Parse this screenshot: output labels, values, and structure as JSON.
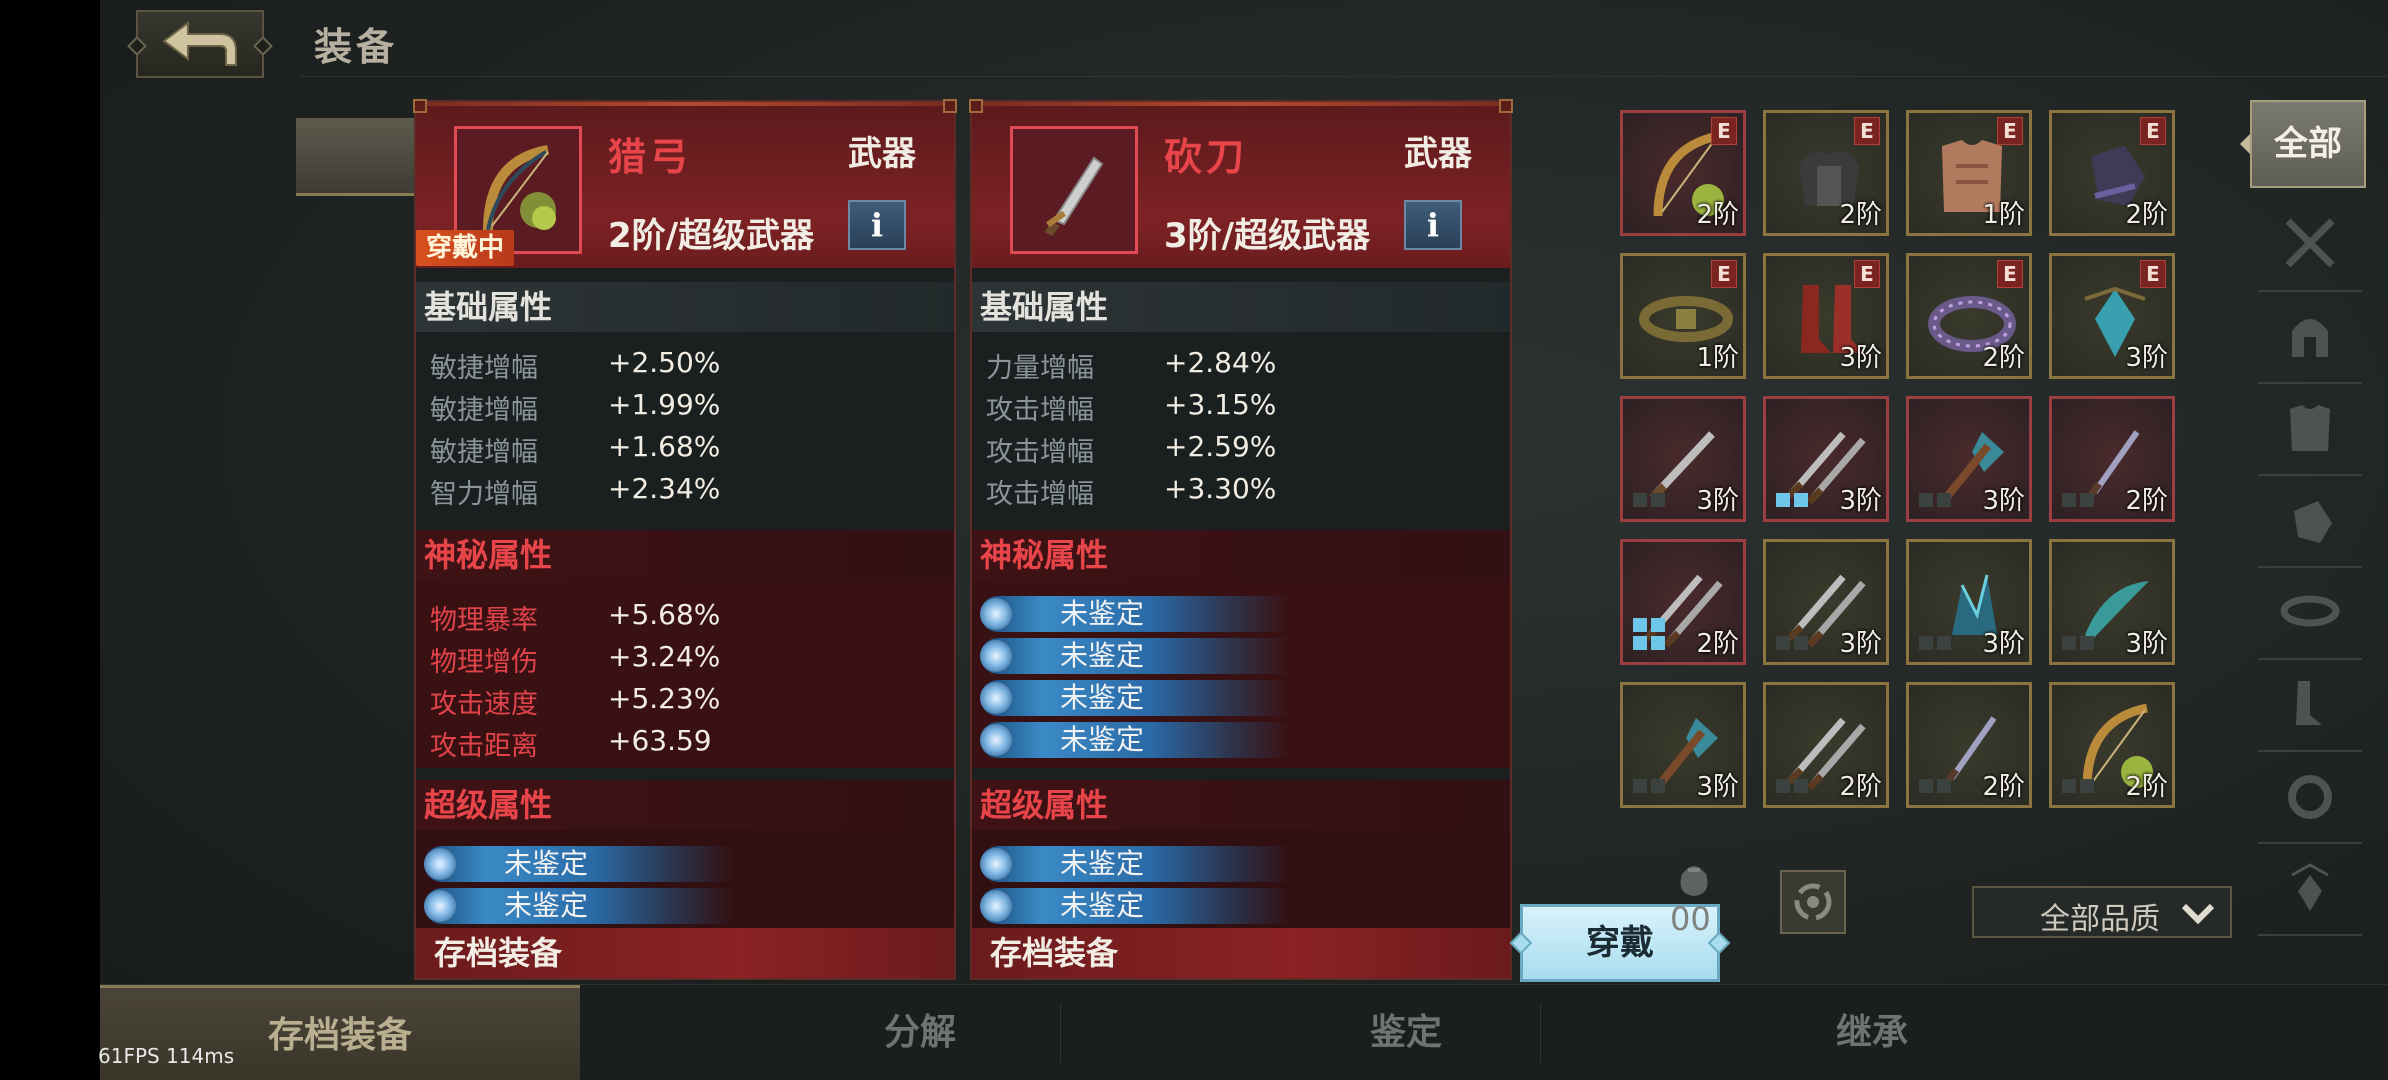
{
  "header": {
    "title": "装备",
    "back_icon": "back-arrow-icon"
  },
  "cards": [
    {
      "name": "猎弓",
      "type": "武器",
      "tier": "2阶/超级武器",
      "equipped_badge": "穿戴中",
      "icon": "bow-icon",
      "basic_title": "基础属性",
      "basic": [
        {
          "label": "敏捷增幅",
          "value": "+2.50%"
        },
        {
          "label": "敏捷增幅",
          "value": "+1.99%"
        },
        {
          "label": "敏捷增幅",
          "value": "+1.68%"
        },
        {
          "label": "智力增幅",
          "value": "+2.34%"
        }
      ],
      "mystic_title": "神秘属性",
      "mystic": [
        {
          "label": "物理暴率",
          "value": "+5.68%"
        },
        {
          "label": "物理增伤",
          "value": "+3.24%"
        },
        {
          "label": "攻击速度",
          "value": "+5.23%"
        },
        {
          "label": "攻击距离",
          "value": "+63.59"
        }
      ],
      "super_title": "超级属性",
      "super": [
        "未鉴定",
        "未鉴定"
      ],
      "footer": "存档装备"
    },
    {
      "name": "砍刀",
      "type": "武器",
      "tier": "3阶/超级武器",
      "icon": "machete-icon",
      "basic_title": "基础属性",
      "basic": [
        {
          "label": "力量增幅",
          "value": "+2.84%"
        },
        {
          "label": "攻击增幅",
          "value": "+3.15%"
        },
        {
          "label": "攻击增幅",
          "value": "+2.59%"
        },
        {
          "label": "攻击增幅",
          "value": "+3.30%"
        }
      ],
      "mystic_title": "神秘属性",
      "mystic_unidentified": [
        "未鉴定",
        "未鉴定",
        "未鉴定",
        "未鉴定"
      ],
      "super_title": "超级属性",
      "super": [
        "未鉴定",
        "未鉴定"
      ],
      "footer": "存档装备"
    }
  ],
  "equip_button": "穿戴",
  "inventory": [
    {
      "icon": "bow-icon",
      "tier": "2阶",
      "e": "E",
      "quality": "red"
    },
    {
      "icon": "shoulder-armor-icon",
      "tier": "2阶",
      "e": "E",
      "quality": "gold"
    },
    {
      "icon": "chest-armor-icon",
      "tier": "1阶",
      "e": "E",
      "quality": "gold"
    },
    {
      "icon": "gauntlet-icon",
      "tier": "2阶",
      "e": "E",
      "quality": "gold"
    },
    {
      "icon": "belt-icon",
      "tier": "1阶",
      "e": "E",
      "quality": "gold"
    },
    {
      "icon": "boots-icon",
      "tier": "3阶",
      "e": "E",
      "quality": "gold"
    },
    {
      "icon": "ring-icon",
      "tier": "2阶",
      "e": "E",
      "quality": "gold"
    },
    {
      "icon": "amulet-icon",
      "tier": "3阶",
      "e": "E",
      "quality": "gold"
    },
    {
      "icon": "sword-icon",
      "tier": "3阶",
      "quality": "red",
      "marks": "dark"
    },
    {
      "icon": "dual-swords-icon",
      "tier": "3阶",
      "quality": "red",
      "marks": "blue"
    },
    {
      "icon": "axe-icon",
      "tier": "3阶",
      "quality": "red",
      "marks": "dark"
    },
    {
      "icon": "dagger-icon",
      "tier": "2阶",
      "quality": "red",
      "marks": "dark"
    },
    {
      "icon": "dual-swords-icon",
      "tier": "2阶",
      "quality": "red",
      "marks": "blue"
    },
    {
      "icon": "dual-swords-icon",
      "tier": "3阶",
      "quality": "gold",
      "marks": "dark"
    },
    {
      "icon": "crystal-icon",
      "tier": "3阶",
      "quality": "gold",
      "marks": "dark"
    },
    {
      "icon": "scimitar-icon",
      "tier": "3阶",
      "quality": "gold",
      "marks": "dark"
    },
    {
      "icon": "axe-icon",
      "tier": "3阶",
      "quality": "gold",
      "marks": "dark"
    },
    {
      "icon": "dual-swords-icon",
      "tier": "2阶",
      "quality": "gold",
      "marks": "dark"
    },
    {
      "icon": "dagger-icon",
      "tier": "2阶",
      "quality": "gold",
      "marks": "dark"
    },
    {
      "icon": "bow-icon",
      "tier": "2阶",
      "quality": "gold",
      "marks": "dark"
    }
  ],
  "categories": {
    "all_label": "全部",
    "icons": [
      "crossed-swords-icon",
      "helmet-icon",
      "armor-icon",
      "gauntlet-icon",
      "belt-icon",
      "boots-icon",
      "ring-icon",
      "amulet-icon"
    ]
  },
  "bag": {
    "icon": "bag-icon",
    "count": "00"
  },
  "quality_filter": {
    "label": "全部品质"
  },
  "bottom_tabs": [
    "存档装备",
    "分解",
    "鉴定",
    "继承"
  ],
  "fps": {
    "text": "61FPS    114ms"
  },
  "colors": {
    "accent_red": "#e8454a",
    "gold_border": "#8b7440",
    "equip_button": "#bfe6f4"
  }
}
